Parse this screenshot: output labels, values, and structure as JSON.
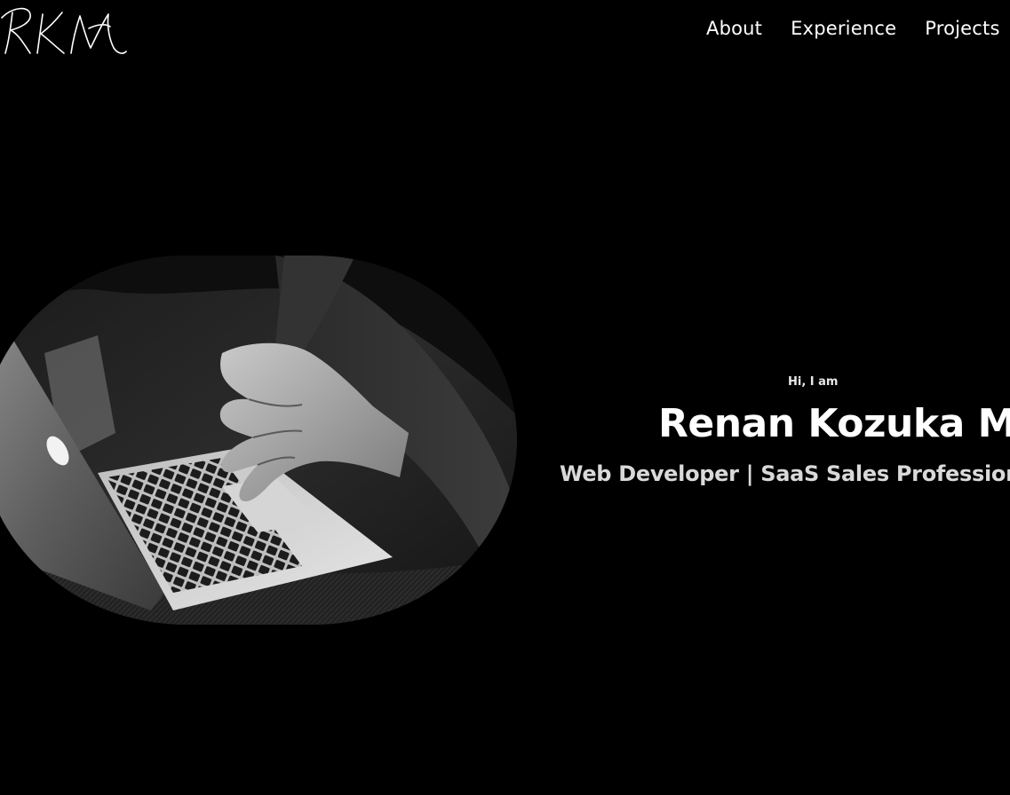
{
  "header": {
    "logo_text": "RKM",
    "nav": [
      {
        "label": "About"
      },
      {
        "label": "Experience"
      },
      {
        "label": "Projects"
      }
    ]
  },
  "hero": {
    "greeting": "Hi, I am",
    "name": "Renan Kozuka Mica",
    "role": "Web Developer | SaaS Sales Professional",
    "image_icon": "laptop-photo"
  },
  "colors": {
    "background": "#000000",
    "text": "#ffffff",
    "subtext": "#d9d9d9"
  }
}
